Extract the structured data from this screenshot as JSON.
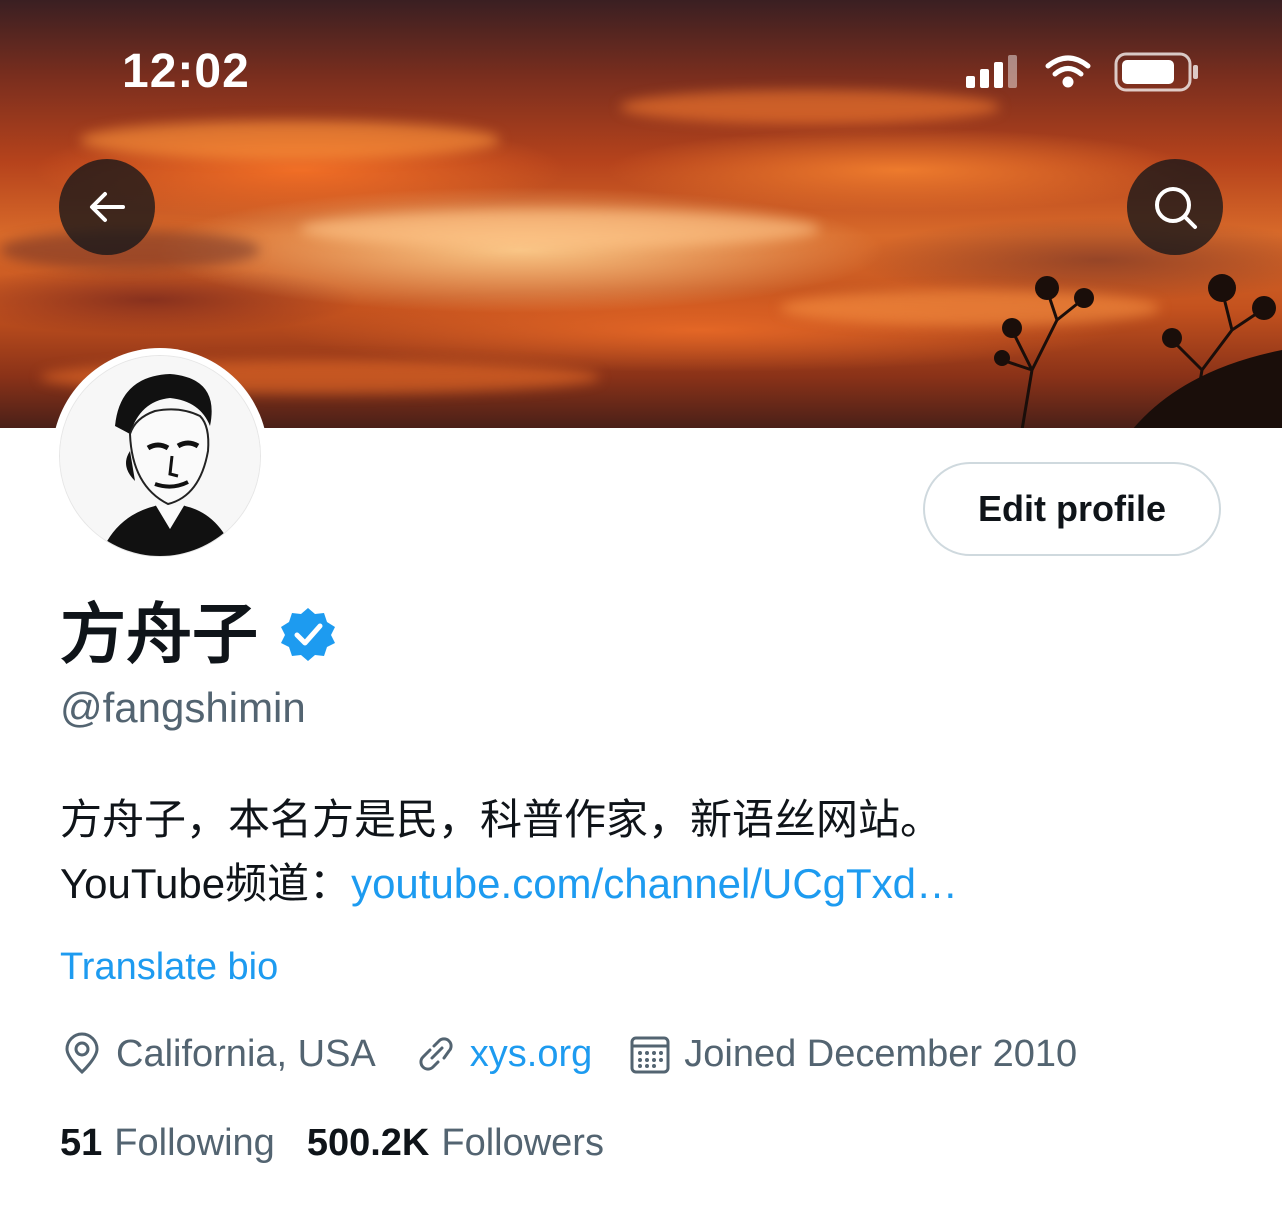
{
  "status_bar": {
    "time": "12:02"
  },
  "profile": {
    "display_name": "方舟子",
    "handle": "@fangshimin",
    "edit_button_label": "Edit profile",
    "bio_line1": "方舟子，本名方是民，科普作家，新语丝网站。",
    "bio_line2_prefix": "YouTube频道：",
    "bio_link": "youtube.com/channel/UCgTxd…",
    "translate_label": "Translate bio",
    "location": "California, USA",
    "website": "xys.org",
    "joined": "Joined December 2010",
    "following_count": "51",
    "following_label": "Following",
    "followers_count": "500.2K",
    "followers_label": "Followers"
  },
  "icons": {
    "back": "arrow-left-icon",
    "search": "search-icon",
    "verified": "verified-badge-icon",
    "location": "location-pin-icon",
    "link": "link-icon",
    "calendar": "calendar-icon"
  },
  "colors": {
    "accent": "#1d9bf0",
    "secondary_text": "#536471",
    "primary_text": "#0f1419"
  }
}
